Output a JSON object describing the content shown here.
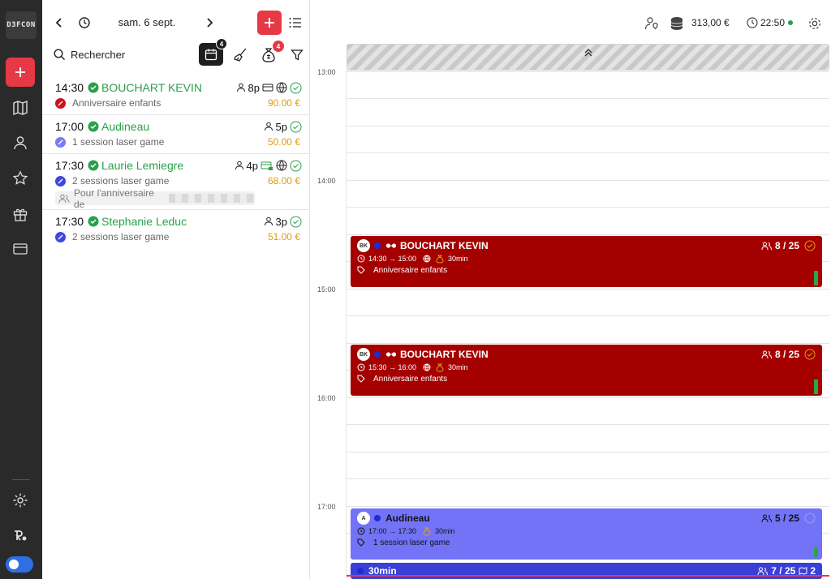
{
  "rail": {
    "logo_text": "D3FCON",
    "icons": [
      "plus-icon",
      "map-icon",
      "user-icon",
      "star-icon",
      "gift-icon",
      "card-icon",
      "settings-icon",
      "brand-icon"
    ]
  },
  "panel": {
    "date": "sam. 6 sept.",
    "search_placeholder": "Rechercher",
    "calendar_badge": "4",
    "moneybag_badge": "4",
    "reservations": [
      {
        "time": "14:30",
        "name": "BOUCHART KEVIN",
        "people": "8p",
        "activity": "Anniversaire enfants",
        "price": "90.00 €",
        "tag_color": "#c4161c"
      },
      {
        "time": "17:00",
        "name": "Audineau",
        "people": "5p",
        "activity": "1 session laser game",
        "price": "50.00 €",
        "tag_color": "#7a7af5"
      },
      {
        "time": "17:30",
        "name": "Laurie Lemiegre",
        "people": "4p",
        "activity": "2 sessions laser game",
        "price": "68.00 €",
        "tag_color": "#3f47e0",
        "note": "Pour l'anniversaire de"
      },
      {
        "time": "17:30",
        "name": "Stephanie Leduc",
        "people": "3p",
        "activity": "2 sessions laser game",
        "price": "51.00 €",
        "tag_color": "#3f47e0"
      }
    ]
  },
  "header": {
    "revenue": "313,00 €",
    "clock": "22:50"
  },
  "calendar": {
    "hours": [
      "13:00",
      "14:00",
      "15:00",
      "16:00",
      "17:00"
    ],
    "events": [
      {
        "initials": "BK",
        "name": "BOUCHART KEVIN",
        "count": "8 / 25",
        "range": "14:30 → 15:00",
        "duration": "30min",
        "label": "Anniversaire enfants"
      },
      {
        "initials": "BK",
        "name": "BOUCHART KEVIN",
        "count": "8 / 25",
        "range": "15:30 → 16:00",
        "duration": "30min",
        "label": "Anniversaire enfants"
      },
      {
        "initials": "A",
        "name": "Audineau",
        "count": "5 / 25",
        "range": "17:00 → 17:30",
        "duration": "30min",
        "label": "1 session laser game"
      }
    ],
    "bottom_event": {
      "label": "30min",
      "count": "7 / 25",
      "extra": "2"
    }
  }
}
